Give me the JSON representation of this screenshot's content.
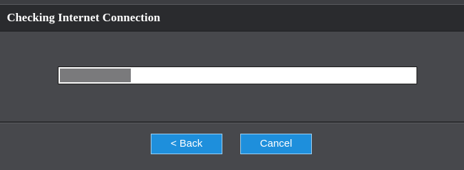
{
  "dialog": {
    "title": "Checking Internet Connection"
  },
  "progress": {
    "fraction": 0.2
  },
  "buttons": {
    "back_label": "< Back",
    "cancel_label": "Cancel"
  },
  "colors": {
    "header_bg": "#2a2b2e",
    "panel_bg": "#47484c",
    "button_bg": "#1e8fdc",
    "progress_fill": "#7a7a7c"
  }
}
